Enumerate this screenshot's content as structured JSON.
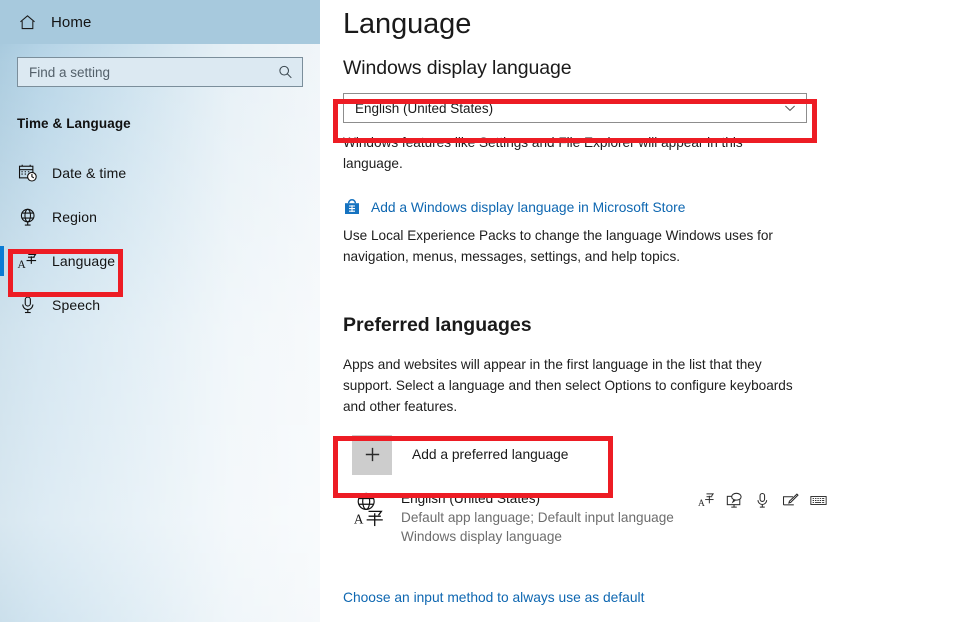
{
  "sidebar": {
    "home": {
      "label": "Home",
      "icon": "home-icon"
    },
    "search": {
      "value": "",
      "placeholder": "Find a setting",
      "icon": "search-icon"
    },
    "group_title": "Time & Language",
    "items": [
      {
        "label": "Date & time",
        "icon": "calendar-clock-icon",
        "selected": false
      },
      {
        "label": "Region",
        "icon": "globe-icon",
        "selected": false
      },
      {
        "label": "Language",
        "icon": "language-icon",
        "selected": true
      },
      {
        "label": "Speech",
        "icon": "microphone-icon",
        "selected": false
      }
    ]
  },
  "content": {
    "page_title": "Language",
    "display_language": {
      "heading": "Windows display language",
      "selected_value": "English (United States)",
      "dropdown_icon": "chevron-down-icon",
      "description": "Windows features like Settings and File Explorer will appear in this language.",
      "store_link": "Add a Windows display language in Microsoft Store",
      "store_icon": "microsoft-store-icon",
      "store_description": "Use Local Experience Packs to change the language Windows uses for navigation, menus, messages, settings, and help topics."
    },
    "preferred_languages": {
      "heading": "Preferred languages",
      "description": "Apps and websites will appear in the first language in the list that they support. Select a language and then select Options to configure keyboards and other features.",
      "add_button": {
        "label": "Add a preferred language",
        "icon": "plus-icon"
      },
      "languages": [
        {
          "name": "English (United States)",
          "flag_icon": "globe-language-icon",
          "sub1": "Default app language; Default input language",
          "sub2": "Windows display language",
          "feature_icons": [
            "language-pack-icon",
            "display-language-icon",
            "speech-icon",
            "handwriting-icon",
            "keyboard-icon"
          ]
        }
      ],
      "bottom_link": "Choose an input method to always use as default"
    }
  },
  "annotations": {
    "highlight_color": "#ed1c24",
    "boxes": [
      {
        "name": "sidebar-language-highlight"
      },
      {
        "name": "display-language-dropdown-highlight"
      },
      {
        "name": "add-preferred-language-highlight"
      }
    ]
  },
  "colors": {
    "accent": "#0a7bd4",
    "link": "#0e67b1",
    "highlight": "#ed1c24",
    "sidebar_top": "#a7c9dd"
  }
}
